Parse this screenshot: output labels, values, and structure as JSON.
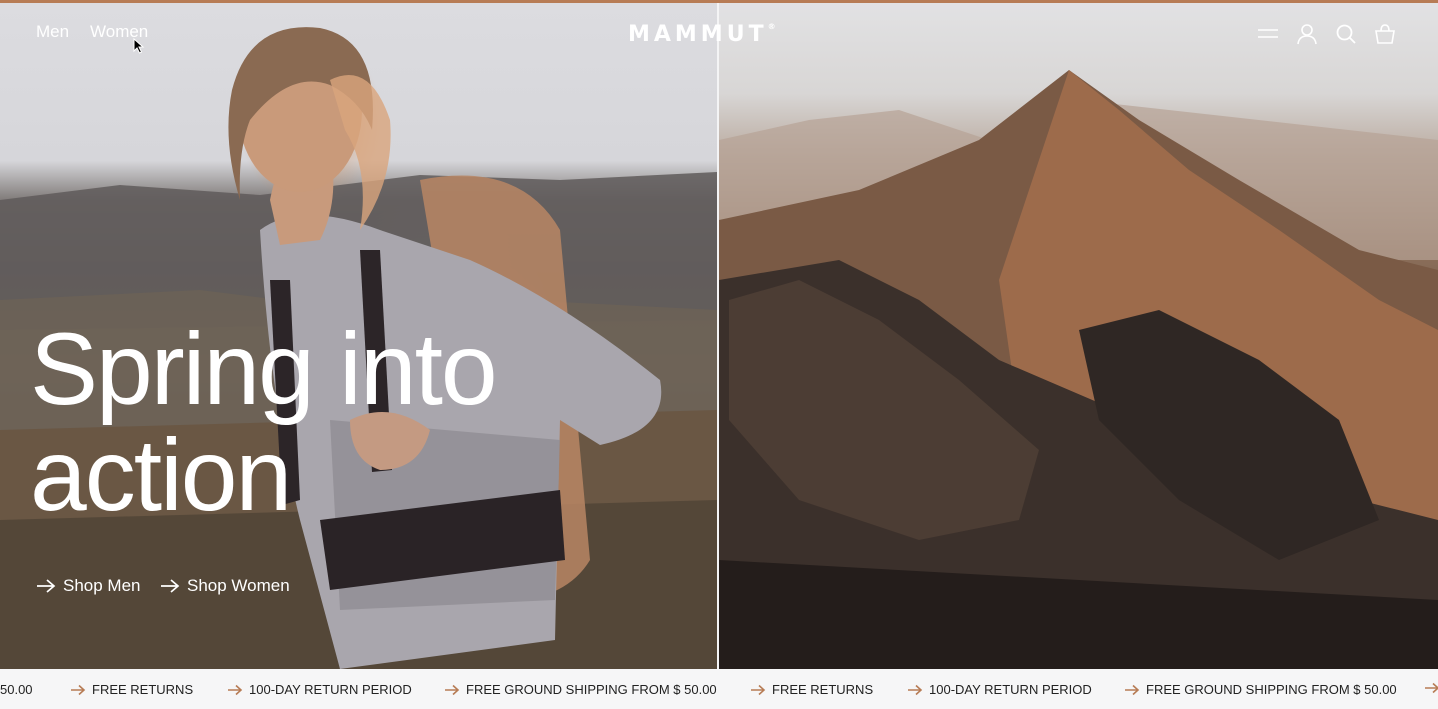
{
  "nav": {
    "men_label": "Men",
    "women_label": "Women",
    "logo_text": "MAMMUT",
    "logo_mark": "®",
    "icons": [
      "menu-icon",
      "account-icon",
      "search-icon",
      "cart-icon"
    ]
  },
  "hero": {
    "headline_line1": "Spring into",
    "headline_line2": "action",
    "shop_men_label": "Shop Men",
    "shop_women_label": "Shop Women"
  },
  "ticker": {
    "partial_start": "50.00",
    "items": [
      "FREE RETURNS",
      "100-DAY RETURN PERIOD",
      "FREE GROUND SHIPPING FROM $ 50.00",
      "FREE RETURNS",
      "100-DAY RETURN PERIOD",
      "FREE GROUND SHIPPING FROM $ 50.00"
    ]
  },
  "colors": {
    "accent_bar": "#b77c55",
    "arrow_accent": "#b77c55",
    "text_light": "#ffffff",
    "ticker_text": "#222222"
  }
}
